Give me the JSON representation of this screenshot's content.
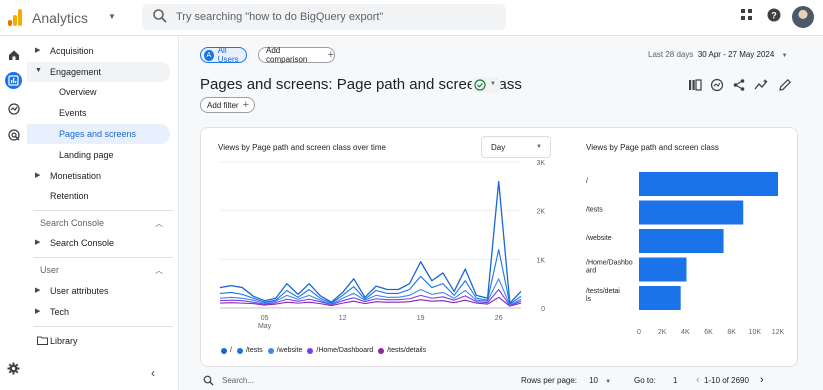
{
  "app": {
    "name": "Analytics",
    "search_placeholder": "Try searching \"how to do BigQuery export\""
  },
  "sidebar": {
    "items": [
      {
        "label": "Acquisition"
      },
      {
        "label": "Engagement"
      },
      {
        "label": "Overview"
      },
      {
        "label": "Events"
      },
      {
        "label": "Pages and screens"
      },
      {
        "label": "Landing page"
      },
      {
        "label": "Monetisation"
      },
      {
        "label": "Retention"
      }
    ],
    "search_console": {
      "header": "Search Console",
      "item": "Search Console"
    },
    "user": {
      "header": "User",
      "items": [
        "User attributes",
        "Tech"
      ]
    },
    "library": "Library"
  },
  "header": {
    "segment": "All Users",
    "segment_badge": "A",
    "add_comparison": "Add comparison",
    "date_label": "Last 28 days",
    "date_range": "30 Apr - 27 May 2024",
    "title": "Pages and screens: Page path and screen class",
    "add_filter": "Add filter"
  },
  "card": {
    "line_title": "Views by Page path and screen class over time",
    "granularity": "Day",
    "bar_title": "Views by Page path and screen class"
  },
  "colors": {
    "accent": "#1a73e8",
    "series": [
      "#1967d2",
      "#1a73e8",
      "#4285f4",
      "#7a3df0",
      "#8e24aa"
    ]
  },
  "chart_data": [
    {
      "type": "line",
      "title": "Views by Page path and screen class over time",
      "x_ticks": [
        {
          "day": 5,
          "label": "05",
          "sublabel": "May"
        },
        {
          "day": 12,
          "label": "12"
        },
        {
          "day": 19,
          "label": "19"
        },
        {
          "day": 26,
          "label": "26"
        }
      ],
      "x": [
        1,
        2,
        3,
        4,
        5,
        6,
        7,
        8,
        9,
        10,
        11,
        12,
        13,
        14,
        15,
        16,
        17,
        18,
        19,
        20,
        21,
        22,
        23,
        24,
        25,
        26,
        27,
        28
      ],
      "y_ticks": [
        0,
        1000,
        2000,
        3000
      ],
      "y_tick_labels": [
        "0",
        "1K",
        "2K",
        "3K"
      ],
      "ylim": [
        0,
        3000
      ],
      "series": [
        {
          "name": "/",
          "values": [
            420,
            460,
            420,
            240,
            150,
            200,
            500,
            280,
            500,
            250,
            120,
            320,
            600,
            220,
            450,
            380,
            380,
            500,
            950,
            560,
            720,
            340,
            800,
            260,
            200,
            2600,
            100,
            340
          ]
        },
        {
          "name": "/tests",
          "values": [
            300,
            320,
            280,
            200,
            120,
            160,
            360,
            220,
            380,
            200,
            100,
            260,
            440,
            180,
            360,
            300,
            300,
            380,
            650,
            420,
            500,
            260,
            560,
            200,
            160,
            1200,
            80,
            240
          ]
        },
        {
          "name": "/website",
          "values": [
            200,
            220,
            200,
            160,
            100,
            140,
            260,
            180,
            260,
            160,
            80,
            200,
            300,
            160,
            260,
            220,
            220,
            260,
            380,
            280,
            320,
            200,
            360,
            160,
            140,
            600,
            60,
            180
          ]
        },
        {
          "name": "/Home/Dashboard",
          "values": [
            150,
            160,
            150,
            120,
            80,
            110,
            180,
            140,
            180,
            130,
            70,
            150,
            210,
            130,
            190,
            170,
            170,
            190,
            260,
            200,
            230,
            160,
            250,
            130,
            110,
            380,
            50,
            140
          ]
        },
        {
          "name": "/tests/details",
          "values": [
            100,
            110,
            100,
            90,
            60,
            80,
            120,
            100,
            120,
            90,
            50,
            100,
            140,
            90,
            130,
            120,
            120,
            130,
            170,
            140,
            150,
            110,
            160,
            100,
            80,
            220,
            40,
            100
          ]
        }
      ]
    },
    {
      "type": "bar",
      "orientation": "horizontal",
      "title": "Views by Page path and screen class",
      "categories": [
        "/",
        "/tests",
        "/website",
        "/Home/Dashboard",
        "/tests/details"
      ],
      "values": [
        12000,
        9000,
        7300,
        4100,
        3600
      ],
      "xlim": [
        0,
        12000
      ],
      "x_ticks": [
        0,
        2000,
        4000,
        6000,
        8000,
        10000,
        12000
      ],
      "x_tick_labels": [
        "0",
        "2K",
        "4K",
        "6K",
        "8K",
        "10K",
        "12K"
      ]
    }
  ],
  "table_controls": {
    "search_placeholder": "Search...",
    "rows_per_page_label": "Rows per page:",
    "rows_per_page": "10",
    "go_to_label": "Go to:",
    "go_to_value": "1",
    "range": "1-10 of 2690"
  }
}
